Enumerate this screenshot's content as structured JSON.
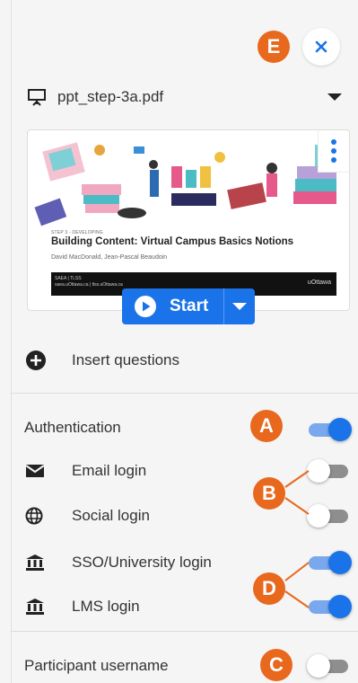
{
  "file": {
    "name": "ppt_step-3a.pdf"
  },
  "slide": {
    "step_label": "STEP 3 - DEVELOPING",
    "title": "Building Content: Virtual Campus Basics Notions",
    "authors": "David MacDonald, Jean-Pascal Beaudoin",
    "footer_left_line1": "SAEA | TLSS",
    "footer_left_line2": "saea.uOttawa.ca | tlss.uOttawa.ca",
    "footer_right": "uOttawa"
  },
  "start": {
    "label": "Start"
  },
  "insert": {
    "label": "Insert questions"
  },
  "auth": {
    "label": "Authentication",
    "enabled": true,
    "options": [
      {
        "label": "Email login",
        "enabled": false,
        "icon": "envelope-icon"
      },
      {
        "label": "Social login",
        "enabled": false,
        "icon": "globe-icon"
      },
      {
        "label": "SSO/University login",
        "enabled": true,
        "icon": "institution-icon"
      },
      {
        "label": "LMS login",
        "enabled": true,
        "icon": "institution-icon"
      }
    ]
  },
  "participant_username": {
    "label": "Participant username",
    "enabled": false
  },
  "annotations": {
    "a": "A",
    "b": "B",
    "c": "C",
    "d": "D",
    "e": "E"
  },
  "colors": {
    "accent": "#1a73e8",
    "badge": "#e8681e"
  }
}
